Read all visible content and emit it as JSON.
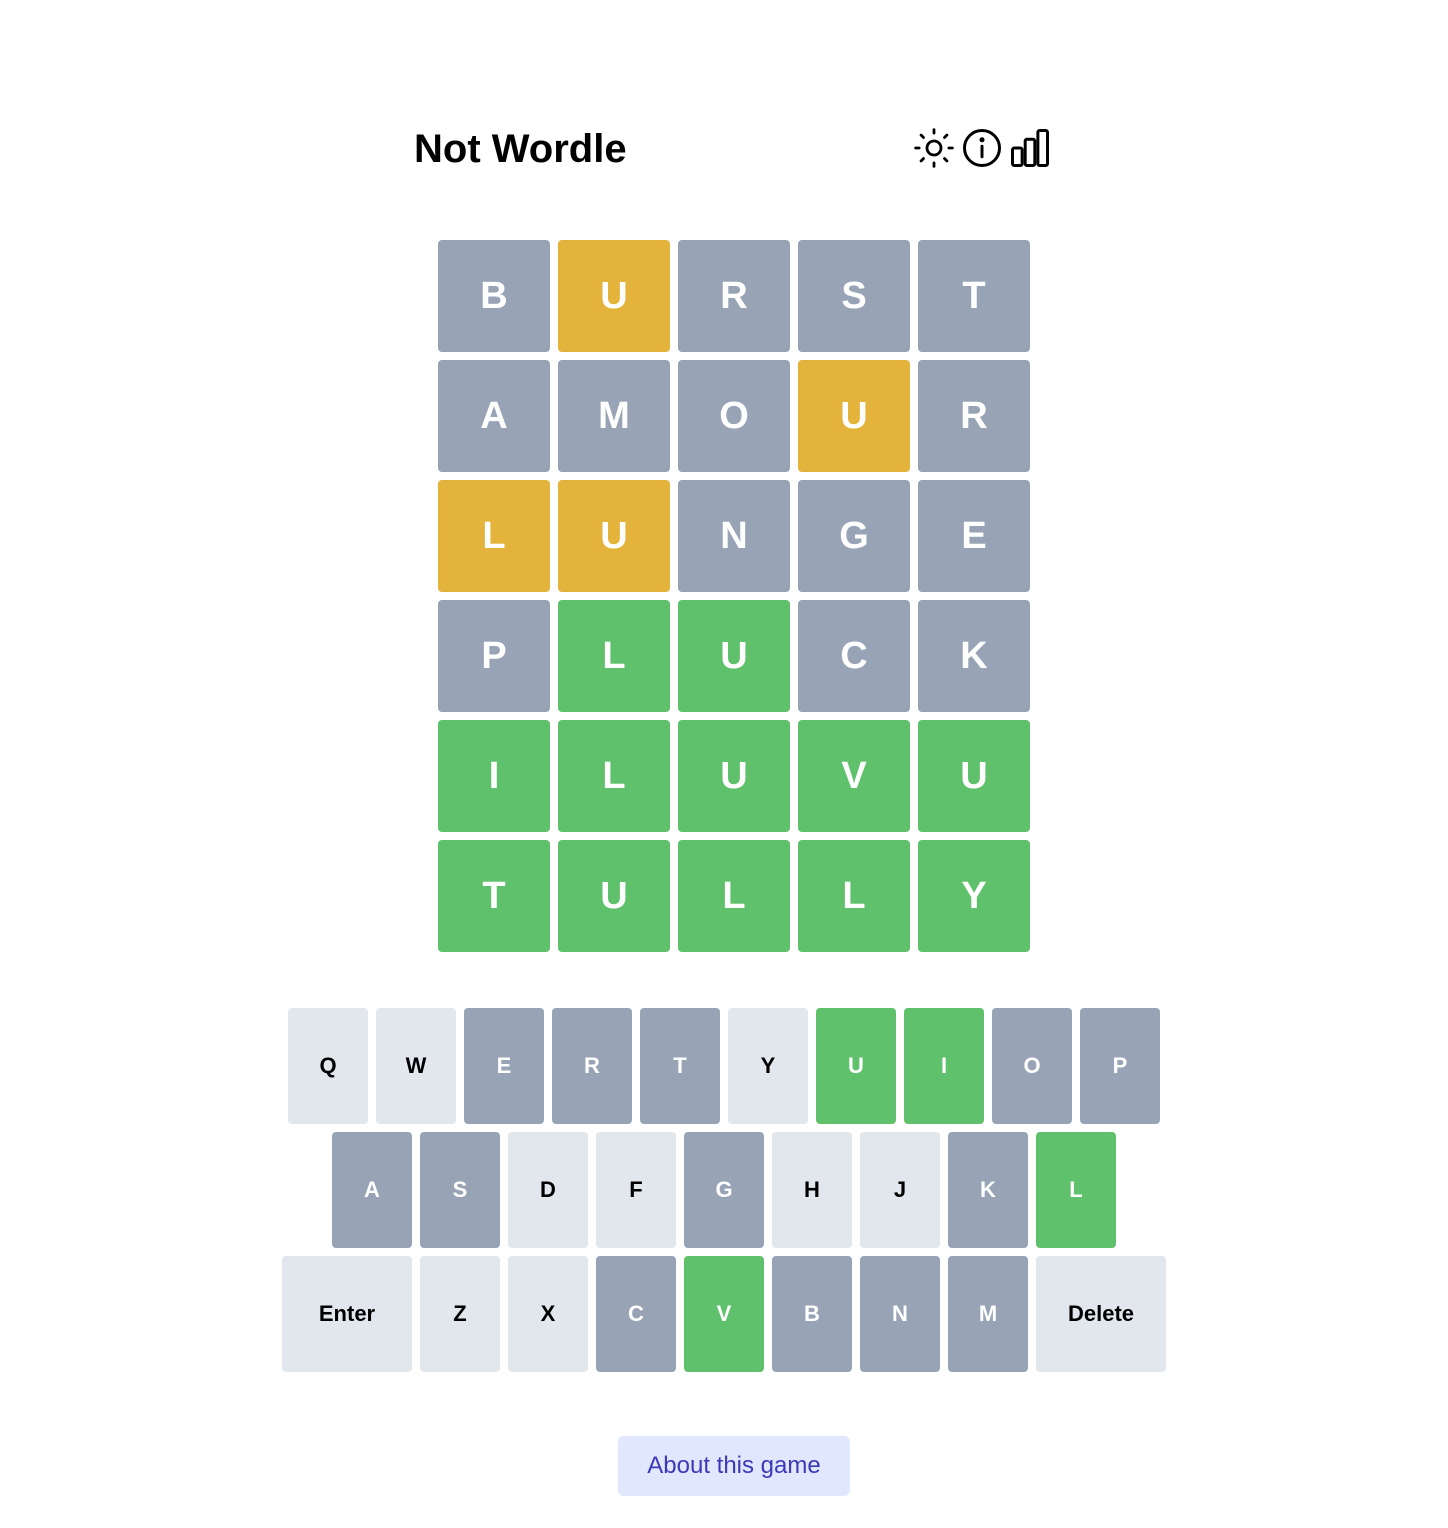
{
  "header": {
    "title": "Not Wordle",
    "icons": [
      "sun-icon",
      "info-icon",
      "stats-chart-icon"
    ]
  },
  "colors": {
    "absent": "#98a4b6",
    "present": "#e3b33c",
    "correct": "#5fc16b",
    "key_unused": "#e2e7ee",
    "key_text_dark": "#000000",
    "tile_text": "#ffffff",
    "about_bg": "#e0e7ff",
    "about_text": "#3b39b8"
  },
  "board": [
    [
      {
        "letter": "B",
        "status": "absent"
      },
      {
        "letter": "U",
        "status": "present"
      },
      {
        "letter": "R",
        "status": "absent"
      },
      {
        "letter": "S",
        "status": "absent"
      },
      {
        "letter": "T",
        "status": "absent"
      }
    ],
    [
      {
        "letter": "A",
        "status": "absent"
      },
      {
        "letter": "M",
        "status": "absent"
      },
      {
        "letter": "O",
        "status": "absent"
      },
      {
        "letter": "U",
        "status": "present"
      },
      {
        "letter": "R",
        "status": "absent"
      }
    ],
    [
      {
        "letter": "L",
        "status": "present"
      },
      {
        "letter": "U",
        "status": "present"
      },
      {
        "letter": "N",
        "status": "absent"
      },
      {
        "letter": "G",
        "status": "absent"
      },
      {
        "letter": "E",
        "status": "absent"
      }
    ],
    [
      {
        "letter": "P",
        "status": "absent"
      },
      {
        "letter": "L",
        "status": "correct"
      },
      {
        "letter": "U",
        "status": "correct"
      },
      {
        "letter": "C",
        "status": "absent"
      },
      {
        "letter": "K",
        "status": "absent"
      }
    ],
    [
      {
        "letter": "I",
        "status": "correct"
      },
      {
        "letter": "L",
        "status": "correct"
      },
      {
        "letter": "U",
        "status": "correct"
      },
      {
        "letter": "V",
        "status": "correct"
      },
      {
        "letter": "U",
        "status": "correct"
      }
    ],
    [
      {
        "letter": "T",
        "status": "correct"
      },
      {
        "letter": "U",
        "status": "correct"
      },
      {
        "letter": "L",
        "status": "correct"
      },
      {
        "letter": "L",
        "status": "correct"
      },
      {
        "letter": "Y",
        "status": "correct"
      }
    ]
  ],
  "keyboard": [
    [
      {
        "label": "Q",
        "status": "unused"
      },
      {
        "label": "W",
        "status": "unused"
      },
      {
        "label": "E",
        "status": "absent"
      },
      {
        "label": "R",
        "status": "absent"
      },
      {
        "label": "T",
        "status": "absent"
      },
      {
        "label": "Y",
        "status": "unused"
      },
      {
        "label": "U",
        "status": "correct"
      },
      {
        "label": "I",
        "status": "correct"
      },
      {
        "label": "O",
        "status": "absent"
      },
      {
        "label": "P",
        "status": "absent"
      }
    ],
    [
      {
        "label": "A",
        "status": "absent"
      },
      {
        "label": "S",
        "status": "absent"
      },
      {
        "label": "D",
        "status": "unused"
      },
      {
        "label": "F",
        "status": "unused"
      },
      {
        "label": "G",
        "status": "absent"
      },
      {
        "label": "H",
        "status": "unused"
      },
      {
        "label": "J",
        "status": "unused"
      },
      {
        "label": "K",
        "status": "absent"
      },
      {
        "label": "L",
        "status": "correct"
      }
    ],
    [
      {
        "label": "Enter",
        "status": "unused",
        "wide": true
      },
      {
        "label": "Z",
        "status": "unused"
      },
      {
        "label": "X",
        "status": "unused"
      },
      {
        "label": "C",
        "status": "absent"
      },
      {
        "label": "V",
        "status": "correct"
      },
      {
        "label": "B",
        "status": "absent"
      },
      {
        "label": "N",
        "status": "absent"
      },
      {
        "label": "M",
        "status": "absent"
      },
      {
        "label": "Delete",
        "status": "unused",
        "wide": true
      }
    ]
  ],
  "footer": {
    "about_label": "About this game"
  }
}
